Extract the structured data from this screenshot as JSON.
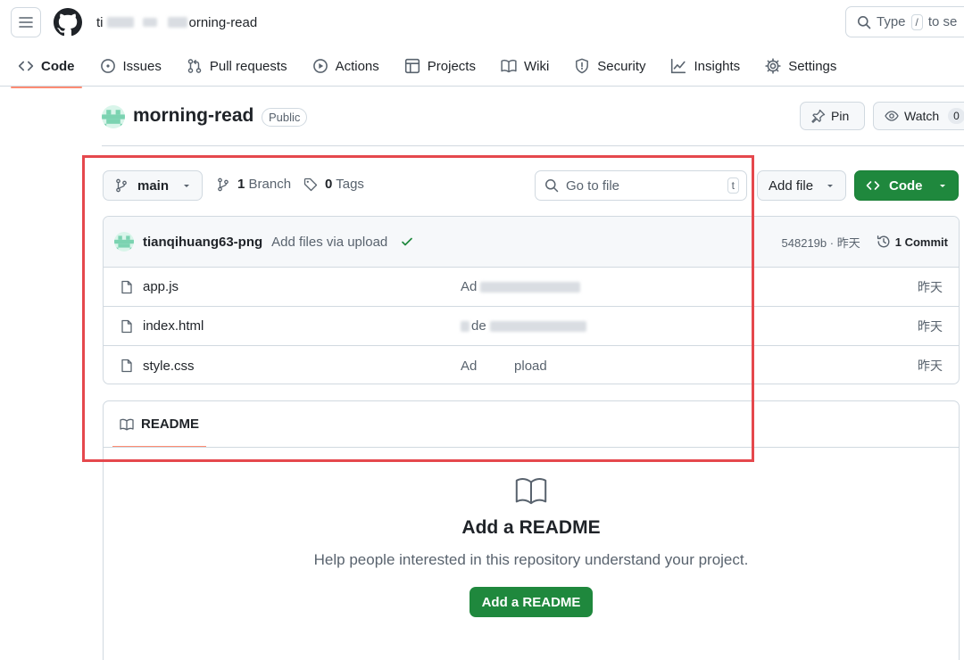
{
  "header": {
    "owner_visible_prefix": "ti",
    "repo_suffix": "orning-read",
    "search_placeholder_pre": "Type",
    "search_key": "/",
    "search_placeholder_post": "to se"
  },
  "tabs": [
    {
      "label": "Code",
      "icon": "code-icon",
      "active": true
    },
    {
      "label": "Issues",
      "icon": "issue-icon"
    },
    {
      "label": "Pull requests",
      "icon": "pull-request-icon"
    },
    {
      "label": "Actions",
      "icon": "play-icon"
    },
    {
      "label": "Projects",
      "icon": "table-icon"
    },
    {
      "label": "Wiki",
      "icon": "book-icon"
    },
    {
      "label": "Security",
      "icon": "shield-icon"
    },
    {
      "label": "Insights",
      "icon": "graph-icon"
    },
    {
      "label": "Settings",
      "icon": "gear-icon"
    }
  ],
  "repo": {
    "name": "morning-read",
    "visibility": "Public",
    "pin_label": "Pin",
    "watch_label": "Watch",
    "watch_count": "0"
  },
  "branchbar": {
    "branch": "main",
    "branch_count": "1",
    "branch_label": "Branch",
    "tag_count": "0",
    "tag_label": "Tags",
    "goto_placeholder": "Go to file",
    "goto_key": "t",
    "add_file": "Add file",
    "code": "Code"
  },
  "commit": {
    "author": "tianqihuang63-png",
    "message": "Add files via upload",
    "hash": "548219b",
    "separator": "·",
    "time": "昨天",
    "count_label": "1 Commit"
  },
  "files": [
    {
      "name": "app.js",
      "message": "Ad",
      "time": "昨天"
    },
    {
      "name": "index.html",
      "message": "de",
      "time": "昨天"
    },
    {
      "name": "style.css",
      "message": "Ad          pload",
      "time": "昨天"
    }
  ],
  "readme": {
    "tab_label": "README",
    "heading": "Add a README",
    "subtext": "Help people interested in this repository understand your project.",
    "button": "Add a README"
  },
  "colors": {
    "accent_green": "#1f883d",
    "tab_underline": "#fd8c73",
    "highlight_red": "#e5484d"
  }
}
